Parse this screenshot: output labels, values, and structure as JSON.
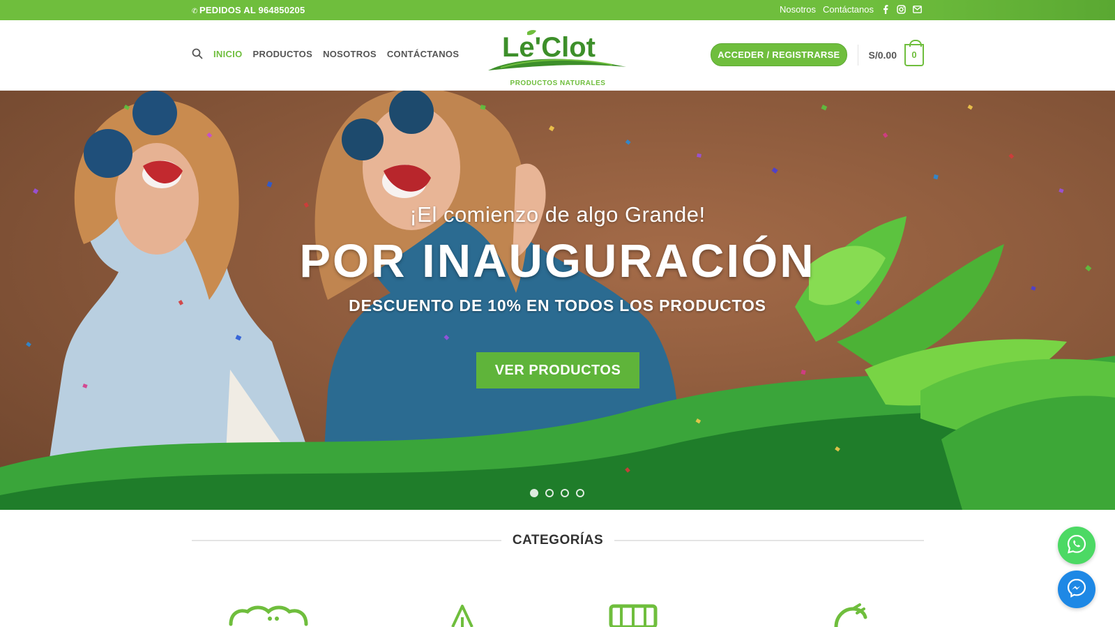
{
  "topbar": {
    "phone_label": "PEDIDOS AL 964850205",
    "links": [
      "Nosotros",
      "Contáctanos"
    ],
    "social_icons": [
      "facebook-icon",
      "instagram-icon",
      "envelope-icon"
    ]
  },
  "header": {
    "nav": [
      "INICIO",
      "PRODUCTOS",
      "NOSOTROS",
      "CONTÁCTANOS"
    ],
    "logo_title": "Le'Clot",
    "logo_subtitle": "PRODUCTOS NATURALES",
    "login_label": "ACCEDER / REGISTRARSE",
    "cart_total": "S/0.00",
    "cart_count": "0"
  },
  "hero": {
    "subtitle": "¡El comienzo de algo Grande!",
    "title": "POR INAUGURACIÓN",
    "description": "DESCUENTO DE 10% EN TODOS LOS PRODUCTOS",
    "cta_label": "VER PRODUCTOS",
    "slides": 4,
    "active_slide": 1
  },
  "categories": {
    "title": "CATEGORÍAS"
  },
  "colors": {
    "brand_green": "#6fbe3d",
    "dark_green": "#3d8f2a",
    "whatsapp": "#4cd964",
    "messenger": "#1e88e5"
  }
}
